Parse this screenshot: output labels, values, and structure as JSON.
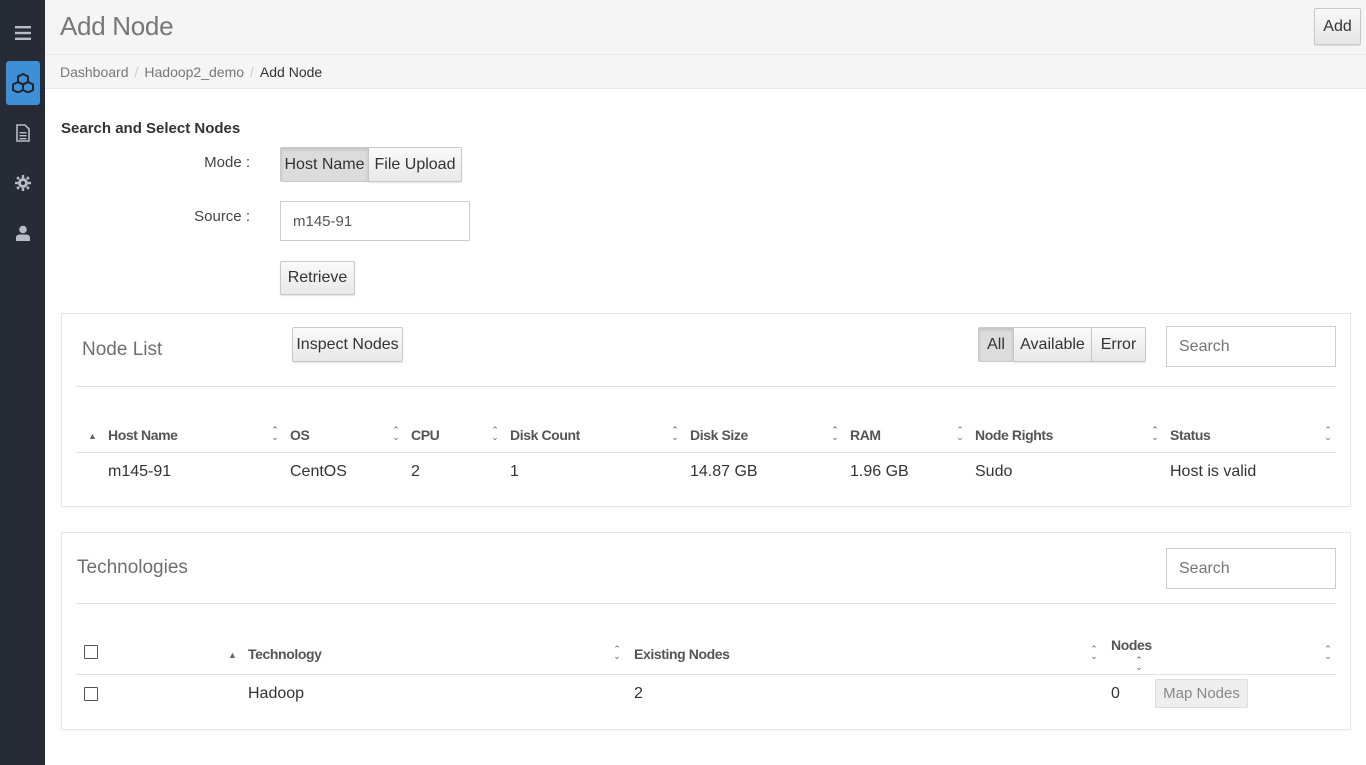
{
  "sidebar": {
    "items": [
      {
        "icon": "menu-icon"
      },
      {
        "icon": "cubes-icon",
        "active": true
      },
      {
        "icon": "document-icon"
      },
      {
        "icon": "gear-icon"
      },
      {
        "icon": "user-icon"
      }
    ],
    "accent": "#3f8fd6"
  },
  "header": {
    "title": "Add Node",
    "add_label": "Add"
  },
  "breadcrumb": [
    "Dashboard",
    "Hadoop2_demo",
    "Add Node"
  ],
  "search_select": {
    "title": "Search and Select Nodes",
    "mode_label": "Mode :",
    "mode_options": [
      "Host Name",
      "File Upload"
    ],
    "mode_selected": "Host Name",
    "source_label": "Source :",
    "source_value": "m145-91",
    "retrieve_label": "Retrieve"
  },
  "node_list": {
    "title": "Node List",
    "inspect_label": "Inspect Nodes",
    "filters": [
      "All",
      "Available",
      "Error"
    ],
    "filter_selected": "All",
    "search_placeholder": "Search",
    "columns": [
      "Host Name",
      "OS",
      "CPU",
      "Disk Count",
      "Disk Size",
      "RAM",
      "Node Rights",
      "Status"
    ],
    "rows": [
      [
        "m145-91",
        "CentOS",
        "2",
        "1",
        "14.87 GB",
        "1.96 GB",
        "Sudo",
        "Host is valid"
      ]
    ]
  },
  "technologies": {
    "title": "Technologies",
    "search_placeholder": "Search",
    "columns": [
      "Technology",
      "Existing Nodes",
      "Nodes"
    ],
    "rows": [
      {
        "name": "Hadoop",
        "existing": "2",
        "nodes": "0",
        "action": "Map Nodes"
      }
    ]
  }
}
